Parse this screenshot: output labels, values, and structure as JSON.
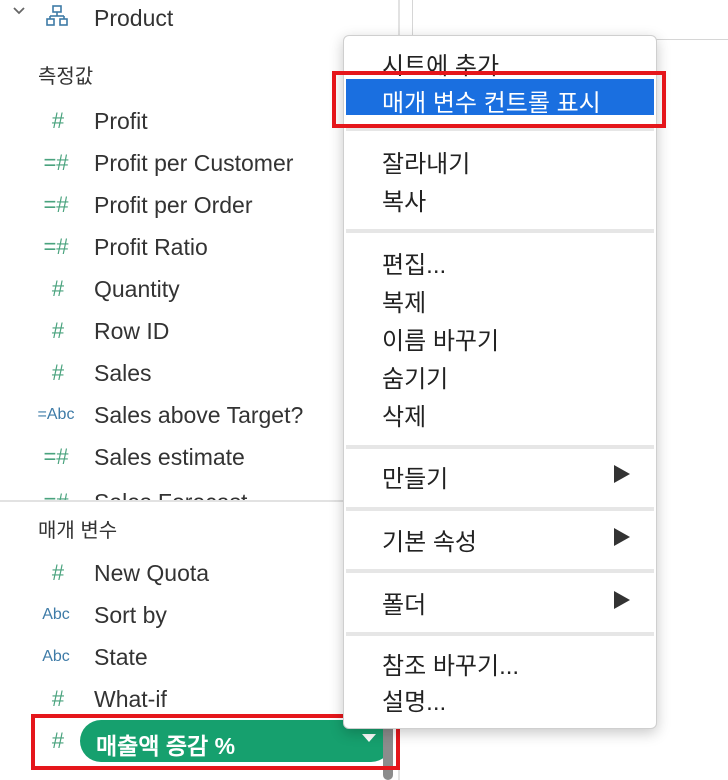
{
  "data_pane": {
    "top_item": {
      "label": "Product",
      "icon": "hierarchy-icon"
    },
    "measures": {
      "title": "측정값",
      "items": [
        {
          "label": "Profit",
          "icon": "#",
          "type": "measure"
        },
        {
          "label": "Profit per Customer",
          "icon": "=#",
          "type": "calc"
        },
        {
          "label": "Profit per Order",
          "icon": "=#",
          "type": "calc"
        },
        {
          "label": "Profit Ratio",
          "icon": "=#",
          "type": "calc"
        },
        {
          "label": "Quantity",
          "icon": "#",
          "type": "measure"
        },
        {
          "label": "Row ID",
          "icon": "#",
          "type": "measure"
        },
        {
          "label": "Sales",
          "icon": "#",
          "type": "measure"
        },
        {
          "label": "Sales above Target?",
          "icon": "=Abc",
          "type": "calc-string"
        },
        {
          "label": "Sales estimate",
          "icon": "=#",
          "type": "calc"
        },
        {
          "label": "Sales Forecast",
          "icon": "=#",
          "type": "calc"
        }
      ]
    },
    "parameters": {
      "title": "매개 변수",
      "items": [
        {
          "label": "New Quota",
          "icon": "#",
          "type": "number"
        },
        {
          "label": "Sort by",
          "icon": "Abc",
          "type": "string"
        },
        {
          "label": "State",
          "icon": "Abc",
          "type": "string"
        },
        {
          "label": "What-if",
          "icon": "#",
          "type": "number"
        }
      ],
      "selected": {
        "label": "매출액 증감 %",
        "icon": "#"
      }
    }
  },
  "context_menu": {
    "items": [
      {
        "label": "시트에 추가"
      },
      {
        "label": "매개 변수 컨트롤 표시",
        "active": true
      },
      {
        "label": "잘라내기"
      },
      {
        "label": "복사"
      },
      {
        "label": "편집..."
      },
      {
        "label": "복제"
      },
      {
        "label": "이름 바꾸기"
      },
      {
        "label": "숨기기"
      },
      {
        "label": "삭제"
      },
      {
        "label": "만들기",
        "submenu": true
      },
      {
        "label": "기본 속성",
        "submenu": true
      },
      {
        "label": "폴더",
        "submenu": true
      },
      {
        "label": "참조 바꾸기..."
      },
      {
        "label": "설명..."
      }
    ]
  },
  "colors": {
    "highlight": "#1a6fe0",
    "pill": "#16a06e",
    "annotation": "#e5161b",
    "measure_icon": "#4aa37e",
    "string_icon": "#3e7ba7"
  }
}
